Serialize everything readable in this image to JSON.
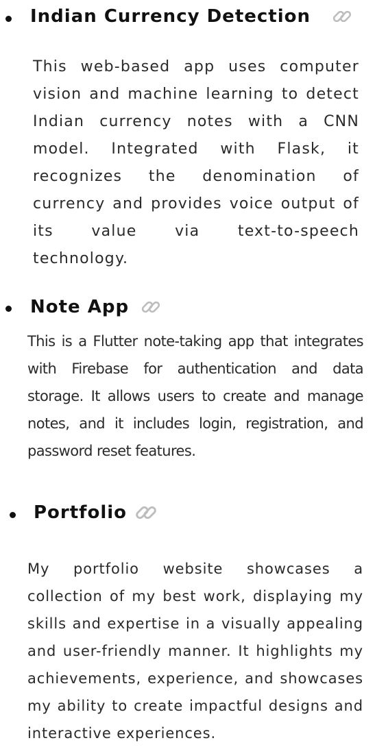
{
  "projects": [
    {
      "title": "Indian Currency Detection",
      "link_icon": "link-icon",
      "description": "This web-based app uses computer vision and machine learning to detect Indian currency notes with a CNN model. Integrated with Flask, it recognizes the denomination of currency and provides voice output of its value via text-to-speech technology."
    },
    {
      "title": "Note App",
      "link_icon": "link-icon",
      "description": "This is a Flutter note-taking app that integrates with Firebase for authentication and data storage. It allows users to create and manage notes, and it includes login, registration, and password reset features."
    },
    {
      "title": "Portfolio",
      "link_icon": "link-icon",
      "description": "My portfolio website showcases a collection of my best work, displaying my skills and expertise in a visually appealing and user-friendly manner. It highlights my achievements, experience, and showcases my ability to create impactful designs and interactive experiences."
    }
  ],
  "colors": {
    "text": "#2a2a2a",
    "title": "#111111",
    "icon": "#bdbdbd"
  }
}
